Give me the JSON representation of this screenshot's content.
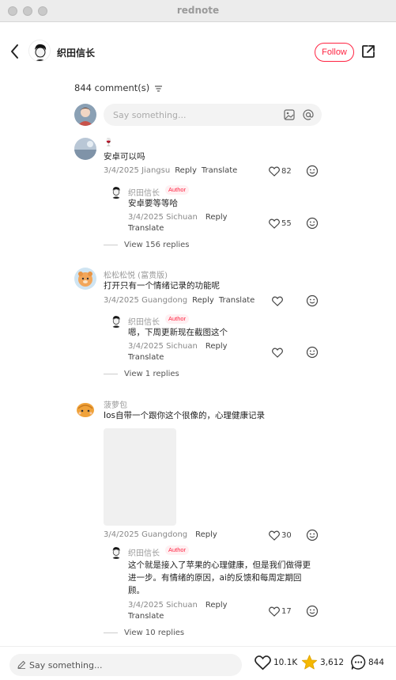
{
  "window": {
    "title": "rednote"
  },
  "header": {
    "author": "织田信长",
    "follow_label": "Follow"
  },
  "comments_header": {
    "count_label": "844 comment(s)"
  },
  "input": {
    "placeholder": "Say something..."
  },
  "comments": [
    {
      "user": "🍷",
      "text": "安卓可以吗",
      "meta": "3/4/2025 Jiangsu",
      "reply_label": "Reply",
      "translate_label": "Translate",
      "likes": "82",
      "reply": {
        "user": "织田信长",
        "badge": "Author",
        "text": "安卓要等等哈",
        "meta": "3/4/2025 Sichuan",
        "reply_label": "Reply",
        "translate_label": "Translate",
        "likes": "55"
      },
      "view_replies": "View 156 replies"
    },
    {
      "user": "松松松悦 (富贵版)",
      "text": "打开只有一个情绪记录的功能呢",
      "meta": "3/4/2025 Guangdong",
      "reply_label": "Reply",
      "translate_label": "Translate",
      "likes": "",
      "reply": {
        "user": "织田信长",
        "badge": "Author",
        "text": "嗯，下周更新现在截图这个",
        "meta": "3/4/2025 Sichuan",
        "reply_label": "Reply",
        "translate_label": "Translate",
        "likes": ""
      },
      "view_replies": "View 1 replies"
    },
    {
      "user": "菠萝包",
      "text": "Ios自带一个跟你这个很像的，心理健康记录",
      "meta": "3/4/2025 Guangdong",
      "reply_label": "Reply",
      "likes": "30",
      "reply": {
        "user": "织田信长",
        "badge": "Author",
        "text_lines": [
          "这个就是接入了苹果的心理健康，但是我们做得更",
          "进一步。有情绪的原因，ai的反馈和每周定期回",
          "顾。"
        ],
        "meta": "3/4/2025 Sichuan",
        "reply_label": "Reply",
        "translate_label": "Translate",
        "likes": "17"
      },
      "view_replies": "View 10 replies"
    }
  ],
  "bottom_bar": {
    "placeholder": "Say something...",
    "likes": "10.1K",
    "collects": "3,612",
    "comments": "844"
  },
  "colors": {
    "accent": "#ff2442",
    "star": "#f5b800"
  },
  "icons": [
    "back-icon",
    "share-icon",
    "sort-icon",
    "image-icon",
    "at-icon",
    "heart-icon",
    "emoji-icon",
    "pencil-icon",
    "star-icon",
    "comment-icon"
  ]
}
